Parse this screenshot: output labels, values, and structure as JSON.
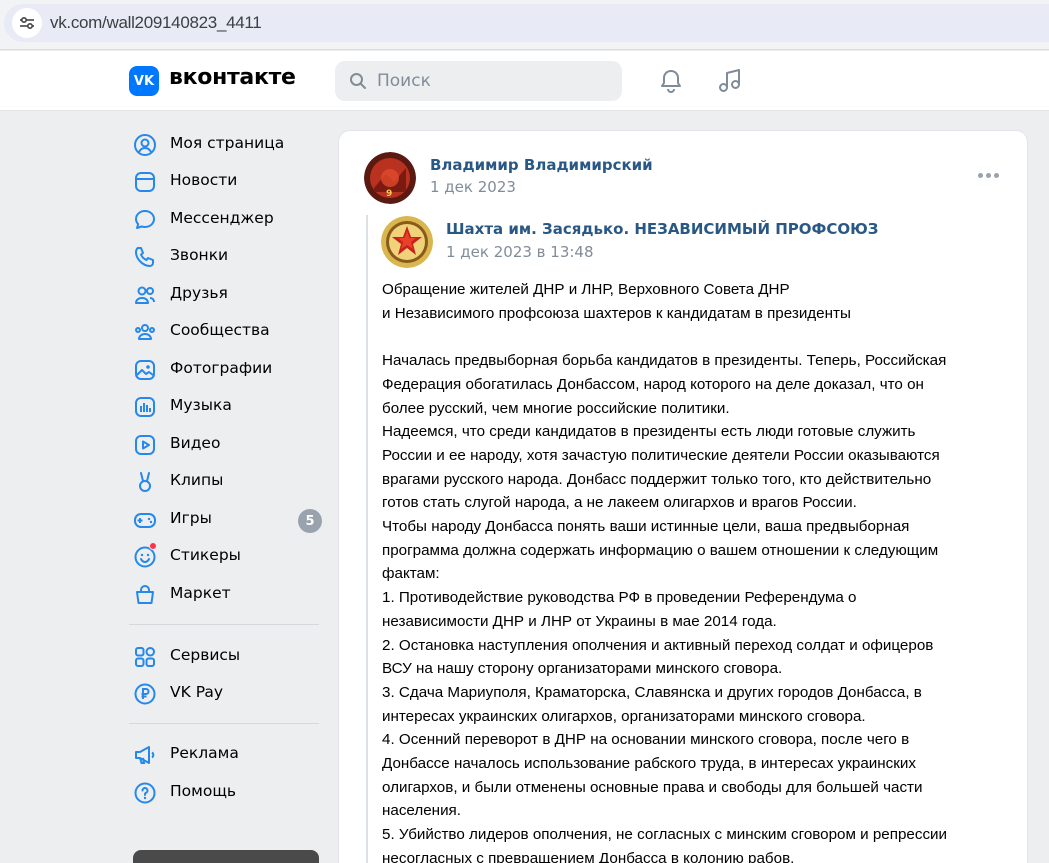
{
  "browser": {
    "url": "vk.com/wall209140823_4411"
  },
  "header": {
    "logo_mark": "VK",
    "wordmark": "вконтакте",
    "search_placeholder": "Поиск"
  },
  "sidebar": {
    "items": [
      {
        "label": "Моя страница",
        "icon": "user-circle-icon"
      },
      {
        "label": "Новости",
        "icon": "news-icon"
      },
      {
        "label": "Мессенджер",
        "icon": "message-bubble-icon"
      },
      {
        "label": "Звонки",
        "icon": "phone-icon"
      },
      {
        "label": "Друзья",
        "icon": "friends-icon"
      },
      {
        "label": "Сообщества",
        "icon": "communities-icon"
      },
      {
        "label": "Фотографии",
        "icon": "photo-icon"
      },
      {
        "label": "Музыка",
        "icon": "music-icon"
      },
      {
        "label": "Видео",
        "icon": "video-icon"
      },
      {
        "label": "Клипы",
        "icon": "clips-icon"
      },
      {
        "label": "Игры",
        "icon": "gamepad-icon",
        "badge": "5"
      },
      {
        "label": "Стикеры",
        "icon": "sticker-icon"
      },
      {
        "label": "Маркет",
        "icon": "market-bag-icon"
      },
      {
        "label": "Сервисы",
        "icon": "services-grid-icon"
      },
      {
        "label": "VK Pay",
        "icon": "ruble-icon"
      },
      {
        "label": "Реклама",
        "icon": "megaphone-icon"
      },
      {
        "label": "Помощь",
        "icon": "help-icon"
      }
    ]
  },
  "post": {
    "author": "Владимир Владимирский",
    "date": "1 дек 2023",
    "repost": {
      "author": "Шахта им. Засядько. НЕЗАВИСИМЫЙ ПРОФСОЮЗ",
      "date": "1 дек 2023 в 13:48"
    },
    "lines": [
      "Обращение жителей ДНР и ЛНР, Верховного Совета ДНР",
      "и Независимого профсоюза шахтеров к кандидатам в президенты",
      "",
      "Началась предвыборная борьба кандидатов в президенты. Теперь, Российская",
      "Федерация обогатилась Донбассом, народ которого на деле доказал, что он",
      "более русский, чем многие российские политики.",
      "Надеемся, что среди кандидатов в президенты есть люди готовые служить",
      "России и ее народу, хотя зачастую политические деятели России оказываются",
      "врагами русского народа. Донбасс поддержит только того, кто действительно",
      "готов стать слугой народа, а не лакеем олигархов и врагов России.",
      "Чтобы народу Донбасса понять ваши истинные цели, ваша предвыборная",
      "программа должна содержать информацию о вашем отношении к следующим",
      "фактам:",
      "1. Противодействие руководства РФ в проведении Референдума о",
      "независимости ДНР и ЛНР от Украины в мае 2014 года.",
      "2. Остановка наступления ополчения и активный переход солдат и офицеров",
      "ВСУ на нашу сторону организаторами минского сговора.",
      "3. Сдача Мариуполя, Краматорска, Славянска и других городов Донбасса, в",
      "интересах украинских олигархов, организаторами минского сговора.",
      "4. Осенний переворот в ДНР на основании минского сговора, после чего в",
      "Донбассе началось использование рабского труда, в интересах украинских",
      "олигархов, и были отменены основные права и свободы для большей части",
      "населения.",
      "5. Убийство лидеров ополчения, не согласных с минским сговором и репрессии",
      "несогласных с превращением Донбасса в колонию рабов."
    ]
  },
  "colors": {
    "vk_blue": "#0077ff",
    "link": "#2a5885",
    "muted": "#818c99",
    "background": "#edeef0"
  }
}
